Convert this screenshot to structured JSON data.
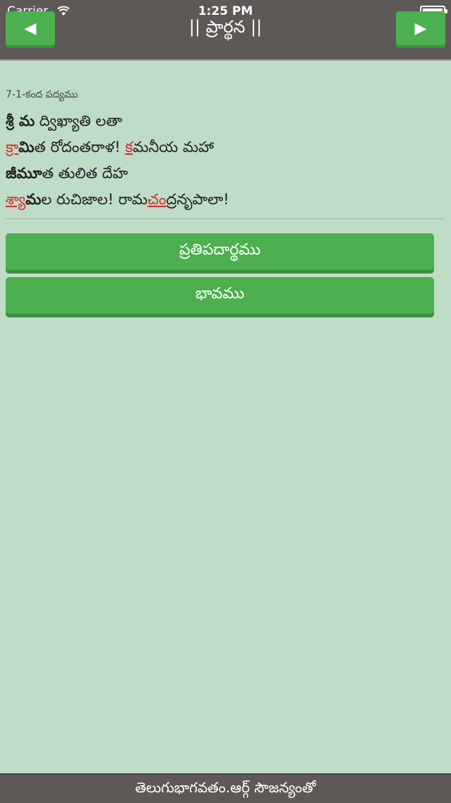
{
  "status_bar": {
    "carrier": "Carrier",
    "time": "1:25 PM",
    "wifi_icon": "wifi-icon",
    "battery_icon": "battery-icon"
  },
  "header": {
    "title": "|| ప్రార్థన ||",
    "prev_label": "◀",
    "next_label": "▶"
  },
  "poem": {
    "meta": "7-1-కంద పద్యము",
    "lines": [
      [
        {
          "t": "శ్రీ మ",
          "s": "bold"
        },
        {
          "t": " ద్విఖ్యాతి లతా",
          "s": "normal"
        }
      ],
      [
        {
          "t": "క్రా",
          "s": "red"
        },
        {
          "t": "మి",
          "s": "bold"
        },
        {
          "t": "త రోదంతరాళ! ",
          "s": "normal"
        },
        {
          "t": "క",
          "s": "red"
        },
        {
          "t": "మనీయ మహా",
          "s": "normal"
        }
      ],
      [
        {
          "t": "జీమూ",
          "s": "bold"
        },
        {
          "t": "త తులిత దేహ",
          "s": "normal"
        }
      ],
      [
        {
          "t": "శ్యా",
          "s": "red"
        },
        {
          "t": "మ",
          "s": "bold"
        },
        {
          "t": "ల రుచిజాల! రామ",
          "s": "normal"
        },
        {
          "t": "చం",
          "s": "red"
        },
        {
          "t": "ద్రనృపాలా!",
          "s": "normal"
        }
      ]
    ]
  },
  "buttons": {
    "meaning": "ప్రతిపదార్థము",
    "bhavamu": "భావము"
  },
  "footer": {
    "text": "తెలుగుభాగవతం.ఆర్గ్ సౌజన్యంతో"
  }
}
